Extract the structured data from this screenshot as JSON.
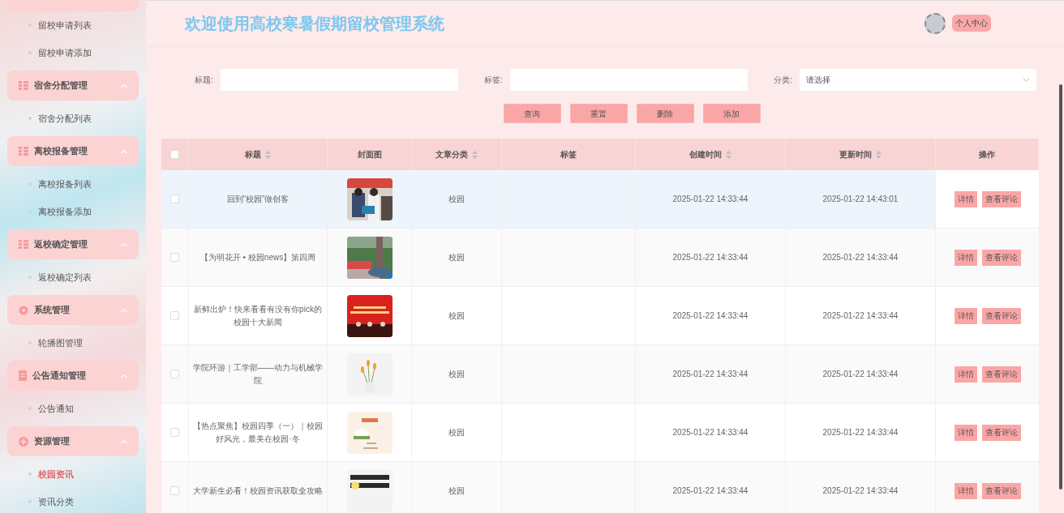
{
  "sidebar": {
    "items": [
      {
        "kind": "item",
        "label": "留校申请列表",
        "selected": false
      },
      {
        "kind": "item",
        "label": "留校申请添加",
        "selected": false
      },
      {
        "kind": "group",
        "label": "宿舍分配管理",
        "expanded": true
      },
      {
        "kind": "item",
        "label": "宿舍分配列表",
        "selected": false
      },
      {
        "kind": "group",
        "label": "离校报备管理",
        "expanded": true
      },
      {
        "kind": "item",
        "label": "离校报备列表",
        "selected": false
      },
      {
        "kind": "item",
        "label": "离校报备添加",
        "selected": false
      },
      {
        "kind": "group",
        "label": "返校确定管理",
        "expanded": true
      },
      {
        "kind": "item",
        "label": "返校确定列表",
        "selected": false
      },
      {
        "kind": "group",
        "label": "系统管理",
        "expanded": true
      },
      {
        "kind": "item",
        "label": "轮播图管理",
        "selected": false
      },
      {
        "kind": "group",
        "label": "公告通知管理",
        "expanded": true
      },
      {
        "kind": "item",
        "label": "公告通知",
        "selected": false
      },
      {
        "kind": "group",
        "label": "资源管理",
        "expanded": true
      },
      {
        "kind": "item",
        "label": "校园资讯",
        "selected": true
      },
      {
        "kind": "item",
        "label": "资讯分类",
        "selected": false
      }
    ]
  },
  "header": {
    "title": "欢迎使用高校寒暑假期留校管理系统",
    "user_button": "个人中心"
  },
  "filters": [
    {
      "kind": "text",
      "label": "标题:"
    },
    {
      "kind": "text",
      "label": "标签:"
    },
    {
      "kind": "select",
      "label": "分类:",
      "placeholder": "请选择"
    }
  ],
  "actions": [
    "查询",
    "重置",
    "删除",
    "添加"
  ],
  "table": {
    "all_checked": false,
    "columns": [
      {
        "label": "标题",
        "sortable": true
      },
      {
        "label": "封面图",
        "sortable": false
      },
      {
        "label": "文章分类",
        "sortable": true
      },
      {
        "label": "标签",
        "sortable": false
      },
      {
        "label": "创建时间",
        "sortable": true
      },
      {
        "label": "更新时间",
        "sortable": true
      },
      {
        "label": "操作",
        "sortable": false
      }
    ],
    "rows": [
      {
        "title": "回到“校园”做创客",
        "cover": {
          "kind": "picture"
        },
        "category": "校园",
        "created": "2025-01-22 14:33:44",
        "updated": "2025-01-22 14:43:01",
        "highlighted": true,
        "checked": false,
        "buttons": [
          "详情",
          "查看评论"
        ]
      },
      {
        "title": "【为明花开 • 校园news】第四周",
        "cover": {
          "kind": "picture"
        },
        "category": "校园",
        "created": "2025-01-22 14:33:44",
        "updated": "2025-01-22 14:33:44",
        "highlighted": false,
        "checked": false,
        "buttons": [
          "详情",
          "查看评论"
        ]
      },
      {
        "title": "新鲜出炉！快来看看有没有你pick的校园十大新闻",
        "cover": {
          "kind": "picture"
        },
        "category": "校园",
        "created": "2025-01-22 14:33:44",
        "updated": "2025-01-22 14:33:44",
        "highlighted": false,
        "checked": false,
        "buttons": [
          "详情",
          "查看评论"
        ]
      },
      {
        "title": "学院环游｜工学部——动力与机械学院",
        "cover": {
          "kind": "picture"
        },
        "category": "校园",
        "created": "2025-01-22 14:33:44",
        "updated": "2025-01-22 14:33:44",
        "highlighted": false,
        "checked": false,
        "buttons": [
          "详情",
          "查看评论"
        ]
      },
      {
        "title": "【热点聚焦】校园四季（一）｜校园好风光，最美在校园·冬",
        "cover": {
          "kind": "picture"
        },
        "category": "校园",
        "created": "2025-01-22 14:33:44",
        "updated": "2025-01-22 14:33:44",
        "highlighted": false,
        "checked": false,
        "buttons": [
          "详情",
          "查看评论"
        ]
      },
      {
        "title": "大学新生必看！校园资讯获取全攻略",
        "cover": {
          "kind": "picture"
        },
        "category": "校园",
        "created": "2025-01-22 14:33:44",
        "updated": "2025-01-22 14:33:44",
        "highlighted": false,
        "checked": false,
        "buttons": [
          "详情",
          "查看评论"
        ]
      }
    ]
  }
}
